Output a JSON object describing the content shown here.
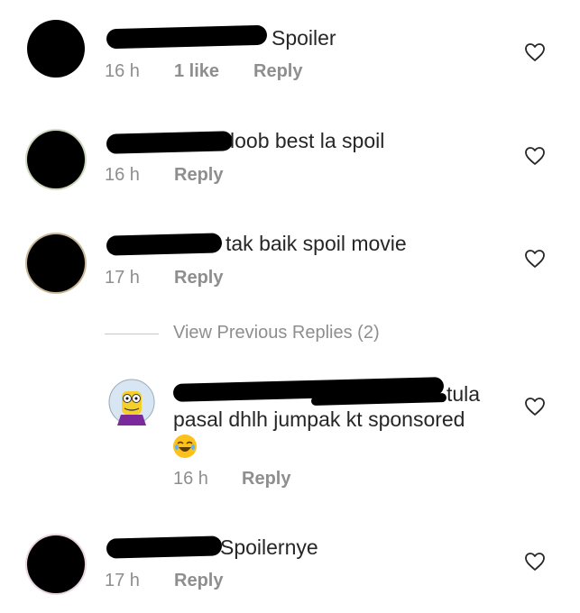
{
  "comments": [
    {
      "text": "Spoiler",
      "time": "16 h",
      "likes": "1 like",
      "reply": "Reply"
    },
    {
      "text": "loob best la spoil",
      "time": "16 h",
      "reply": "Reply"
    },
    {
      "text": "tak baik spoil movie",
      "time": "17 h",
      "reply": "Reply"
    },
    {
      "text": "Spoilernye",
      "time": "17 h",
      "reply": "Reply"
    }
  ],
  "view_previous": "View Previous Replies (2)",
  "reply_comment": {
    "text_line1": "tula",
    "text_line2": "pasal dhlh jumpak kt sponsored",
    "emoji": "😂",
    "time": "16 h",
    "reply": "Reply"
  },
  "colors": {
    "text": "#262626",
    "muted": "#8e8e8e",
    "divider": "#c7c7c7"
  },
  "icons": {
    "like": "heart-outline-icon",
    "avatar": "redacted-avatar"
  }
}
